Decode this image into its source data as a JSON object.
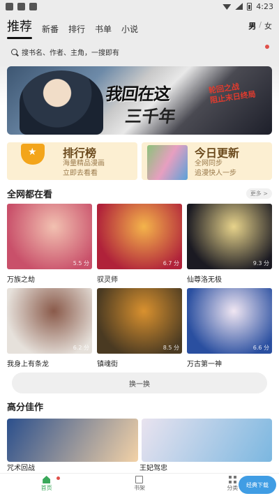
{
  "status_bar": {
    "time": "4:23"
  },
  "header": {
    "tabs": [
      {
        "label": "推荐",
        "active": true
      },
      {
        "label": "新番"
      },
      {
        "label": "排行"
      },
      {
        "label": "书单"
      },
      {
        "label": "小说"
      }
    ],
    "gender": {
      "male": "男",
      "sep": "/",
      "female": "女",
      "selected": "男"
    }
  },
  "search": {
    "placeholder": "搜书名、作者、主角，一搜即有"
  },
  "banner": {
    "title_line1": "我回在这",
    "title_line2": "三千年",
    "slogan_line1": "轮回之战",
    "slogan_line2": "阻止末日终局"
  },
  "promos": [
    {
      "title": "排行榜",
      "subtitle_line1": "海量精品漫画",
      "subtitle_line2": "立即去看看"
    },
    {
      "title": "今日更新",
      "subtitle_line1": "全网同步",
      "subtitle_line2": "追漫快人一步"
    }
  ],
  "section_all": {
    "title": "全网都在看",
    "more_label": "更多 >",
    "items": [
      {
        "title": "万族之劫",
        "score": "5.5 分",
        "color_a": "#c9506a",
        "color_b": "#f2c1b1"
      },
      {
        "title": "驭灵师",
        "score": "6.7 分",
        "color_a": "#b0223a",
        "color_b": "#f4b44b"
      },
      {
        "title": "仙尊洛无极",
        "score": "9.3 分",
        "color_a": "#1b1a22",
        "color_b": "#e7d38b"
      },
      {
        "title": "我身上有条龙",
        "score": "6.2 分",
        "color_a": "#e6e1db",
        "color_b": "#8a5a4a"
      },
      {
        "title": "镇魂街",
        "score": "8.5 分",
        "color_a": "#4a3a22",
        "color_b": "#d9912f"
      },
      {
        "title": "万古第一神",
        "score": "6.6 分",
        "color_a": "#2a4fa0",
        "color_b": "#f0e6f2"
      }
    ]
  },
  "swap_button": {
    "label": "换一换"
  },
  "section_high": {
    "title": "高分佳作",
    "items": [
      {
        "title": "咒术回战",
        "color_a": "#2b4f8c",
        "color_b": "#f3d2a7"
      },
      {
        "title": "王妃驾忠",
        "color_a": "#e9e3ef",
        "color_b": "#7bb7e0"
      }
    ]
  },
  "bottom_nav": [
    {
      "label": "首页",
      "active": true
    },
    {
      "label": "书架"
    },
    {
      "label": "分类"
    }
  ],
  "watermark": {
    "text": "经典下载"
  }
}
